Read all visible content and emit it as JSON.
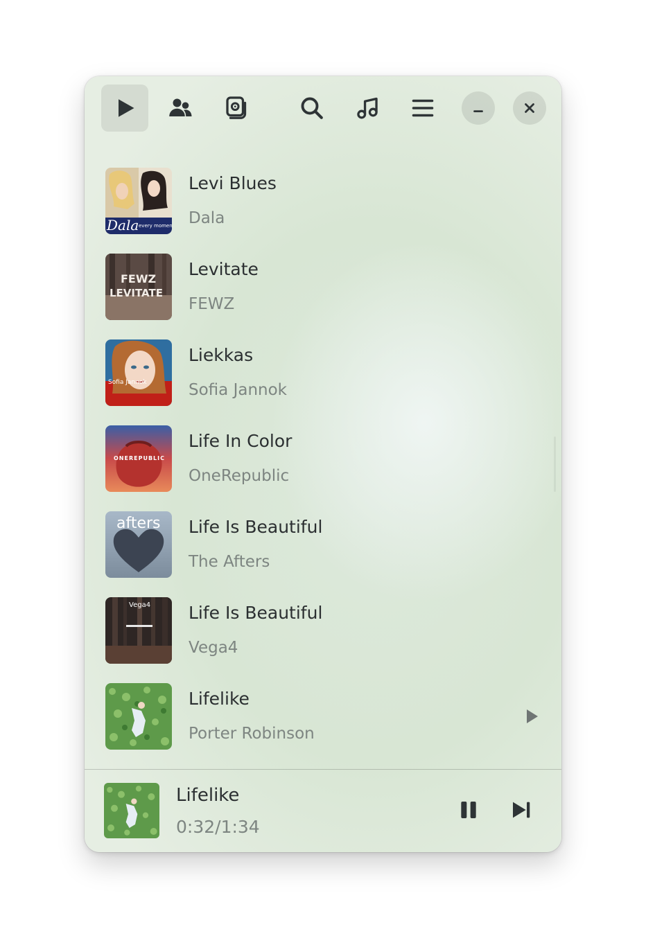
{
  "header": {
    "buttons": [
      {
        "name": "now-playing",
        "icon": "play-icon",
        "active": true
      },
      {
        "name": "artists",
        "icon": "people-icon"
      },
      {
        "name": "albums",
        "icon": "albums-icon"
      },
      {
        "name": "search",
        "icon": "search-icon"
      },
      {
        "name": "songs",
        "icon": "music-note-icon"
      },
      {
        "name": "menu",
        "icon": "hamburger-menu-icon"
      },
      {
        "name": "minimize",
        "icon": "minimize-icon"
      },
      {
        "name": "close",
        "icon": "close-icon"
      }
    ]
  },
  "songs": [
    {
      "title": "Levi Blues",
      "artist": "Dala",
      "art_text": "Dala",
      "art_sub": "every moment is something"
    },
    {
      "title": "Levitate",
      "artist": "FEWZ",
      "art_text": "FEWZ",
      "art_sub": "LEVITATE"
    },
    {
      "title": "Liekkas",
      "artist": "Sofia Jannok",
      "art_text": "Sofia Jannok"
    },
    {
      "title": "Life In Color",
      "artist": "OneRepublic",
      "art_text": "ONEREPUBLIC"
    },
    {
      "title": "Life Is Beautiful",
      "artist": "The Afters",
      "art_text": "afters"
    },
    {
      "title": "Life Is Beautiful",
      "artist": "Vega4",
      "art_text": "Vega4"
    },
    {
      "title": "Lifelike",
      "artist": "Porter Robinson",
      "playing": true
    }
  ],
  "now_playing": {
    "title": "Lifelike",
    "time": "0:32/1:34",
    "progress_seconds": 32,
    "duration_seconds": 94
  },
  "colors": {
    "text": "#2b2f31",
    "subtext": "#7d8581",
    "background": "#dbe8d8"
  }
}
